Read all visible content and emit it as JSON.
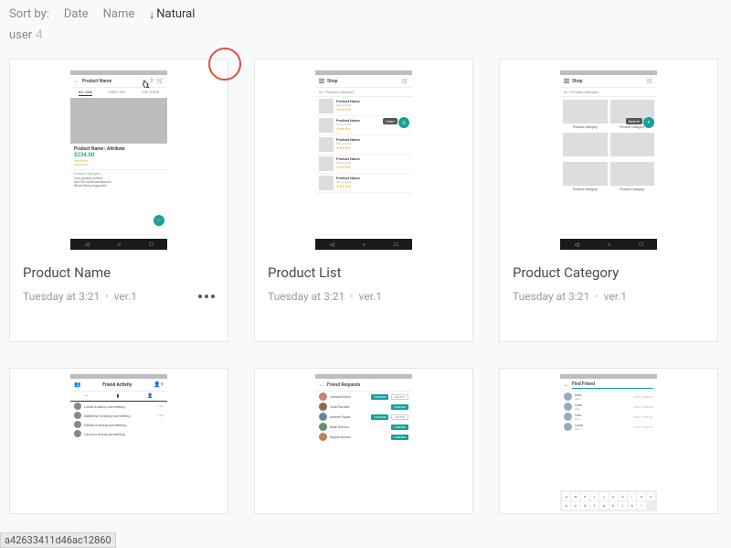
{
  "sort": {
    "label": "Sort by:",
    "options": [
      "Date",
      "Name"
    ],
    "active": "Natural"
  },
  "user": {
    "label": "user",
    "count": "4"
  },
  "footer_id": "a42633411d46ac12860",
  "cards": [
    {
      "title": "Product Name",
      "timestamp": "Tuesday at 3:21",
      "version": "ver.1",
      "show_more": true,
      "preview": {
        "appbar_title": "Product Name",
        "tabs": [
          "NO. ONE",
          "ITEM TWO",
          "THE THIRD"
        ],
        "product_name": "Product Name | Attribute",
        "price": "$234.00",
        "subcaption": "Subcontent",
        "hl_heading": "Product Highlights",
        "bullets": [
          "Your product is here",
          "Don't be confused about it",
          "Weird String Supposed"
        ]
      }
    },
    {
      "title": "Product List",
      "timestamp": "Tuesday at 3:21",
      "version": "ver.1",
      "preview": {
        "appbar_title": "Shop",
        "crumb": "es  ›  Product Category",
        "chip": "Chart",
        "rows": [
          {
            "name": "Product Name",
            "sub": "this enrolled"
          },
          {
            "name": "Product Name",
            "sub": "this enrolled"
          },
          {
            "name": "Product Name",
            "sub": "this enrolled"
          },
          {
            "name": "Product Name",
            "sub": "this enrolled"
          },
          {
            "name": "Product Name",
            "sub": "this enrolled"
          }
        ]
      }
    },
    {
      "title": "Product Category",
      "timestamp": "Tuesday at 3:21",
      "version": "ver.1",
      "preview": {
        "appbar_title": "Shop",
        "crumb": "es  ›  Product Category",
        "search_chip": "Search",
        "cells": [
          "Product Category",
          "Product Category",
          "",
          "",
          "Product Category",
          "Product Category"
        ]
      }
    }
  ],
  "cards2": [
    {
      "preview": {
        "appbar_title": "Friend Activity",
        "rows": [
          {
            "name": "Linda is doing something",
            "time": "1:34p"
          },
          {
            "name": "Matthew is doing something",
            "time": "1:30p"
          },
          {
            "name": "Dallas is doing something",
            "time": ""
          },
          {
            "name": "Laura is doing something",
            "time": ""
          }
        ]
      }
    },
    {
      "preview": {
        "appbar_title": "Friend Requests",
        "rows": [
          {
            "name": "Joshua Rollins",
            "btn": "CONFIRM",
            "btn2": "DELETE",
            "c": "#c9826b"
          },
          {
            "name": "Julia Piumata",
            "btn": "CONFIRM",
            "btn2": "",
            "c": "#8a6a58"
          },
          {
            "name": "Andrew Pupils",
            "btn": "CONFIRM",
            "btn2": "DELETE",
            "c": "#628aa5"
          },
          {
            "name": "Noah Benson",
            "btn": "CONFIRM",
            "btn2": "",
            "c": "#6a8f6f"
          },
          {
            "name": "Sophia Gomez",
            "btn": "CONFIRM",
            "btn2": "",
            "c": "#b6845e"
          }
        ]
      }
    },
    {
      "preview": {
        "appbar_title": "Find Friend",
        "rows": [
          {
            "name": "Dara",
            "sub": "dara"
          },
          {
            "name": "Lana",
            "sub": "lana"
          },
          {
            "name": "Lara",
            "sub": "lara"
          },
          {
            "name": "Laura",
            "sub": "laura"
          }
        ],
        "keys": [
          "q",
          "w",
          "e",
          "r",
          "t",
          "y",
          "u",
          "i",
          "o",
          "p",
          "a",
          "s",
          "d",
          "f",
          "g",
          "h",
          "j",
          "k",
          "l"
        ]
      }
    }
  ]
}
